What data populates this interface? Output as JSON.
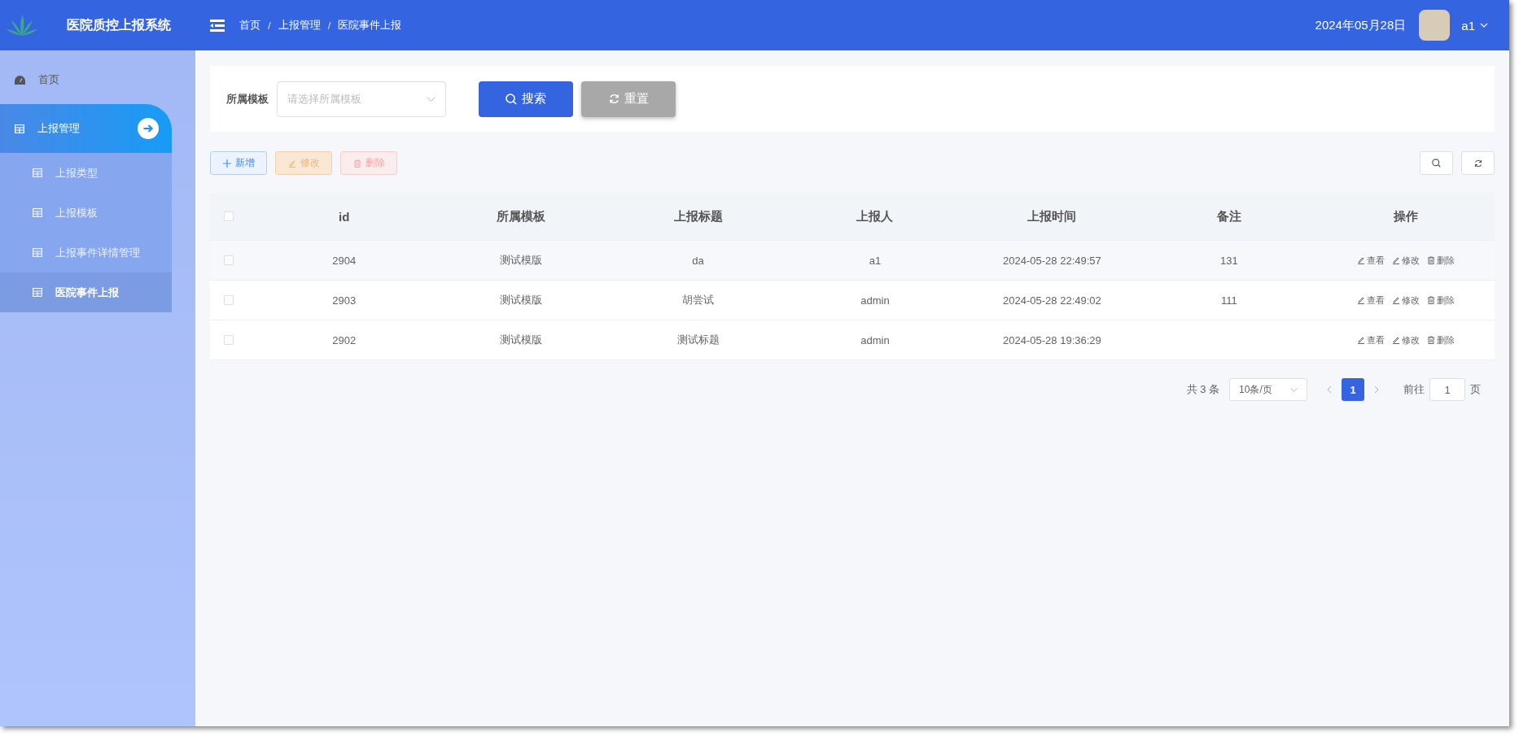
{
  "header": {
    "title": "医院质控上报系统",
    "breadcrumb": [
      "首页",
      "上报管理",
      "医院事件上报"
    ],
    "breadcrumb_separator": "/",
    "date": "2024年05月28日",
    "user": "a1"
  },
  "sidebar": {
    "items": [
      {
        "label": "首页",
        "kind": "link",
        "selected": false
      },
      {
        "label": "上报管理",
        "kind": "group",
        "expanded": true,
        "children": [
          {
            "label": "上报类型",
            "selected": false
          },
          {
            "label": "上报模板",
            "selected": false
          },
          {
            "label": "上报事件详情管理",
            "selected": false
          },
          {
            "label": "医院事件上报",
            "selected": true
          }
        ]
      }
    ]
  },
  "search": {
    "label": "所属模板",
    "placeholder": "请选择所属模板",
    "buttons": [
      {
        "label": "搜索",
        "kind": "primary"
      },
      {
        "label": "重置",
        "kind": "reset"
      }
    ]
  },
  "toolbar": {
    "buttons": [
      {
        "label": "新增",
        "kind": "add",
        "disabled": false
      },
      {
        "label": "修改",
        "kind": "edit",
        "disabled": true
      },
      {
        "label": "删除",
        "kind": "delete",
        "disabled": true
      }
    ]
  },
  "table": {
    "all_checked": false,
    "columns": [
      "id",
      "所属模板",
      "上报标题",
      "上报人",
      "上报时间",
      "备注",
      "操作"
    ],
    "rows": [
      {
        "checked": false,
        "cells": [
          "2904",
          "测试模版",
          "da",
          "a1",
          "2024-05-28 22:49:57",
          "131"
        ],
        "actions": [
          "查看",
          "修改",
          "删除"
        ]
      },
      {
        "checked": false,
        "cells": [
          "2903",
          "测试模版",
          "胡尝试",
          "admin",
          "2024-05-28 22:49:02",
          "111"
        ],
        "actions": [
          "查看",
          "修改",
          "删除"
        ]
      },
      {
        "checked": false,
        "cells": [
          "2902",
          "测试模版",
          "测试标题",
          "admin",
          "2024-05-28 19:36:29",
          ""
        ],
        "actions": [
          "查看",
          "修改",
          "删除"
        ]
      }
    ]
  },
  "pagination": {
    "total": "共 3 条",
    "page_size": "10条/页",
    "pages": [
      {
        "label": "1",
        "selected": true
      }
    ],
    "goto_label": "前往",
    "goto_value": "1",
    "goto_suffix": "页"
  }
}
